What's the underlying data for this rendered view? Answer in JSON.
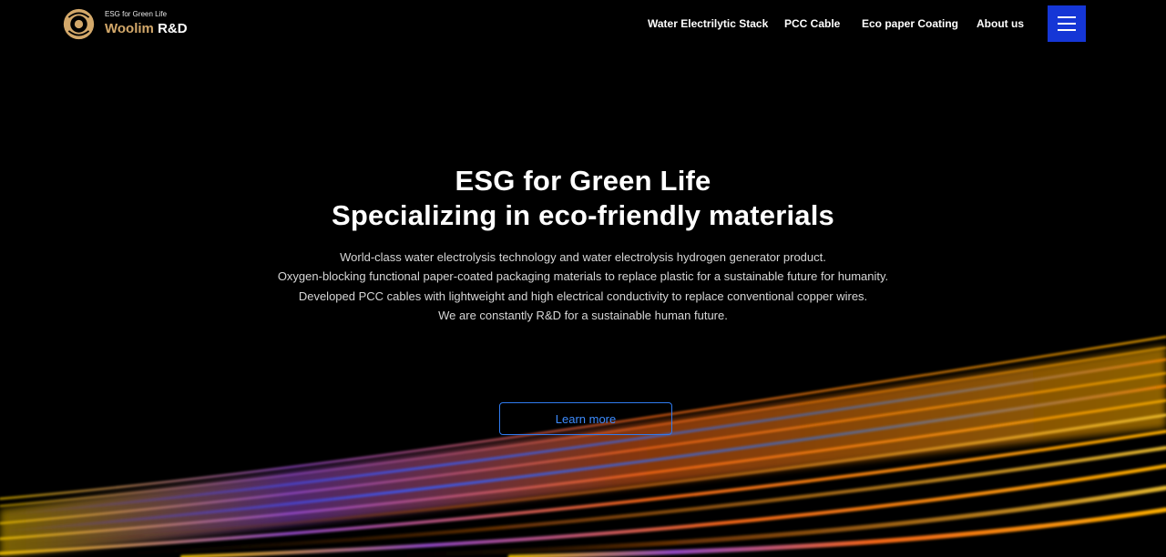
{
  "header": {
    "tagline": "ESG for Green Life",
    "brand_part1": "Woolim",
    "brand_part2": "R&D",
    "nav": [
      {
        "label": "Water Electrilytic Stack"
      },
      {
        "label": "PCC Cable"
      },
      {
        "label": "Eco paper Coating"
      },
      {
        "label": "About us"
      }
    ],
    "menu_icon": "hamburger-menu-icon"
  },
  "hero": {
    "title_line1": "ESG for Green Life",
    "title_line2": "Specializing in eco-friendly materials",
    "description": [
      "World-class water electrolysis technology and water electrolysis hydrogen generator product.",
      "Oxygen-blocking functional paper-coated packaging materials to replace plastic for a sustainable future for humanity.",
      "Developed PCC cables with lightweight and high electrical conductivity to replace conventional copper wires.",
      "We are constantly R&D for a sustainable human future."
    ],
    "cta_label": "Learn more"
  },
  "colors": {
    "background": "#000000",
    "brand_gold": "#d3a86a",
    "menu_button": "#1536d6",
    "cta_border": "#2f7bf0",
    "cta_text": "#3d8cff"
  }
}
